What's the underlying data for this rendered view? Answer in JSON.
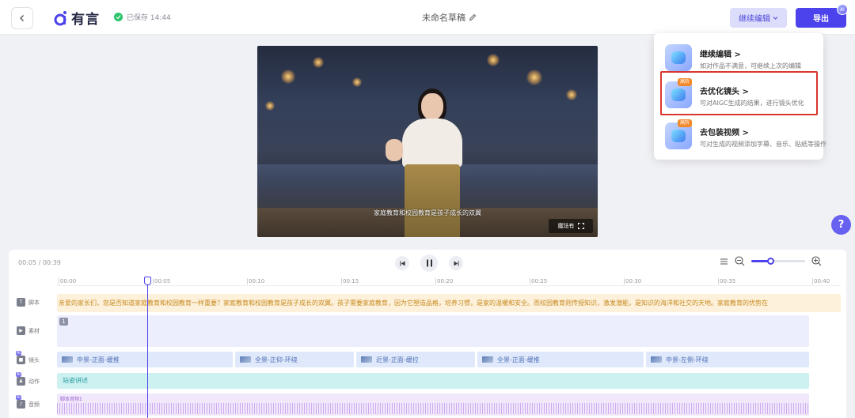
{
  "header": {
    "logo_text": "有言",
    "save_status": "已保存 14:44",
    "doc_title": "未命名草稿",
    "continue_label": "继续编辑",
    "export_label": "导出",
    "avatar_badge": "AI"
  },
  "video": {
    "subtitle": "家庭教育和校园教育是孩子成长的双翼",
    "watermark": "魔珐有"
  },
  "menu": {
    "items": [
      {
        "title": "继续编辑",
        "desc": "如对作品不满意，可继续上次的编辑",
        "badge": ""
      },
      {
        "title": "去优化镜头",
        "desc": "可对AIGC生成的结果，进行镜头优化",
        "badge": "高阶"
      },
      {
        "title": "去包装视频",
        "desc": "可对生成的视频添加字幕、音乐、贴纸等操作",
        "badge": "高阶"
      }
    ]
  },
  "help": {
    "label": "?"
  },
  "timeline": {
    "time_display": "00:05 / 00:39",
    "zoom_level": 0.35,
    "ticks": [
      "00:00",
      "00:05",
      "00:10",
      "00:15",
      "00:20",
      "00:25",
      "00:30",
      "00:35",
      "00:40"
    ],
    "rows": {
      "script": "脚本",
      "material": "素材",
      "shot": "镜头",
      "action": "动作",
      "audio": "音频"
    },
    "ai_tag": "AI",
    "script_text": "亲爱的家长们，您是否知道家庭教育和校园教育一样重要？家庭教育和校园教育是孩子成长的双翼。孩子需要家庭教育，因为它塑造品格，培养习惯，是家的温暖和安全。而校园教育则传授知识，激发潜能，是知识的海洋和社交的天地。家庭教育的优势在",
    "material_number": "1",
    "shots": [
      "中景-正面-缓推",
      "全景-正仰-环绕",
      "近景-正面-缓拉",
      "全景-正面-缓推",
      "中景-左侧-环绕"
    ],
    "action_text": "站姿讲述",
    "audio_label": "脚本音频1"
  }
}
